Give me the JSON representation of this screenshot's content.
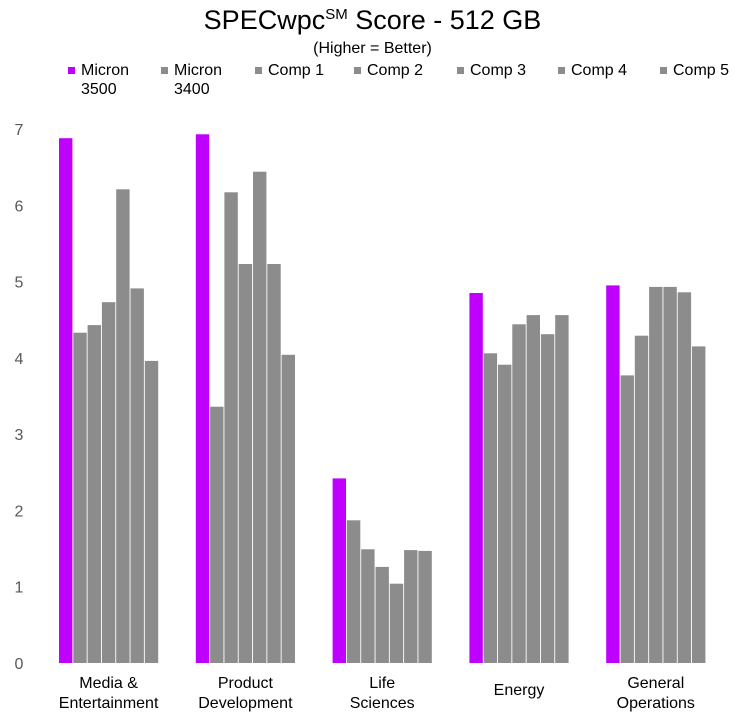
{
  "chart_data": {
    "type": "bar",
    "title": "SPECwpc",
    "title_superscript": "SM",
    "title_suffix": " Score - 512 GB",
    "subtitle": "(Higher = Better)",
    "xlabel": "",
    "ylabel": "",
    "ylim": [
      0,
      7
    ],
    "yticks": [
      "0",
      "1",
      "2",
      "3",
      "4",
      "5",
      "6",
      "7"
    ],
    "grid": false,
    "legend_position": "top",
    "categories": [
      [
        "Media &",
        "Entertainment"
      ],
      [
        "Product",
        "Development"
      ],
      [
        "Life",
        "Sciences"
      ],
      [
        "Energy"
      ],
      [
        "General",
        "Operations"
      ]
    ],
    "series": [
      {
        "name": "Micron 3500",
        "label_lines": [
          "Micron",
          "3500"
        ],
        "color": "#BF00FF",
        "values": [
          6.88,
          6.93,
          2.42,
          4.85,
          4.95
        ]
      },
      {
        "name": "Micron 3400",
        "label_lines": [
          "Micron",
          "3400"
        ],
        "color": "#8C8C8C",
        "values": [
          4.33,
          3.36,
          1.87,
          4.06,
          3.77
        ]
      },
      {
        "name": "Comp 1",
        "label_lines": [
          "Comp 1"
        ],
        "color": "#8C8C8C",
        "values": [
          4.43,
          6.17,
          1.49,
          3.91,
          4.29
        ]
      },
      {
        "name": "Comp 2",
        "label_lines": [
          "Comp 2"
        ],
        "color": "#8C8C8C",
        "values": [
          4.73,
          5.23,
          1.26,
          4.44,
          4.93
        ]
      },
      {
        "name": "Comp 3",
        "label_lines": [
          "Comp 3"
        ],
        "color": "#8C8C8C",
        "values": [
          6.21,
          6.44,
          1.04,
          4.56,
          4.93
        ]
      },
      {
        "name": "Comp 4",
        "label_lines": [
          "Comp 4"
        ],
        "color": "#8C8C8C",
        "values": [
          4.91,
          5.23,
          1.48,
          4.31,
          4.86
        ]
      },
      {
        "name": "Comp 5",
        "label_lines": [
          "Comp 5"
        ],
        "color": "#8C8C8C",
        "values": [
          3.96,
          4.04,
          1.47,
          4.56,
          4.15
        ]
      }
    ]
  }
}
